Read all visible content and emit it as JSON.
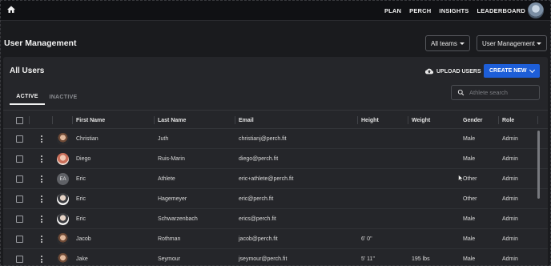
{
  "topnav": {
    "links": [
      "PLAN",
      "PERCH",
      "INSIGHTS",
      "LEADERBOARD"
    ]
  },
  "page": {
    "title": "User Management",
    "team_filter": "All teams",
    "section_select": "User Management"
  },
  "card": {
    "title": "All Users",
    "upload_label": "UPLOAD USERS",
    "create_label": "CREATE NEW",
    "tabs": [
      "ACTIVE",
      "INACTIVE"
    ],
    "search_placeholder": "Athlete search"
  },
  "table": {
    "columns": [
      "First Name",
      "Last Name",
      "Email",
      "Height",
      "Weight",
      "Gender",
      "Role"
    ],
    "rows": [
      {
        "initials": "",
        "first": "Christian",
        "last": "Juth",
        "email": "christianj@perch.fit",
        "height": "",
        "weight": "",
        "gender": "Male",
        "role": "Admin"
      },
      {
        "initials": "",
        "first": "Diego",
        "last": "Ruis-Marin",
        "email": "diego@perch.fit",
        "height": "",
        "weight": "",
        "gender": "Male",
        "role": "Admin"
      },
      {
        "initials": "EA",
        "first": "Eric",
        "last": "Athlete",
        "email": "eric+athlete@perch.fit",
        "height": "",
        "weight": "",
        "gender": "Other",
        "role": "Admin"
      },
      {
        "initials": "",
        "first": "Eric",
        "last": "Hagemeyer",
        "email": "eric@perch.fit",
        "height": "",
        "weight": "",
        "gender": "Other",
        "role": "Admin"
      },
      {
        "initials": "",
        "first": "Eric",
        "last": "Schwarzenbach",
        "email": "erics@perch.fit",
        "height": "",
        "weight": "",
        "gender": "Male",
        "role": "Admin"
      },
      {
        "initials": "",
        "first": "Jacob",
        "last": "Rothman",
        "email": "jacob@perch.fit",
        "height": "6' 0\"",
        "weight": "",
        "gender": "Male",
        "role": "Admin"
      },
      {
        "initials": "",
        "first": "Jake",
        "last": "Seymour",
        "email": "jseymour@perch.fit",
        "height": "5' 11\"",
        "weight": "195 lbs",
        "gender": "Male",
        "role": "Admin"
      }
    ]
  },
  "colors": {
    "background": "#1a1b1e",
    "card": "#25262a",
    "accent": "#1d5ed8"
  },
  "icons": [
    "home-icon",
    "cloud-upload-icon",
    "chevron-down-icon",
    "search-icon",
    "more-vert-icon"
  ]
}
